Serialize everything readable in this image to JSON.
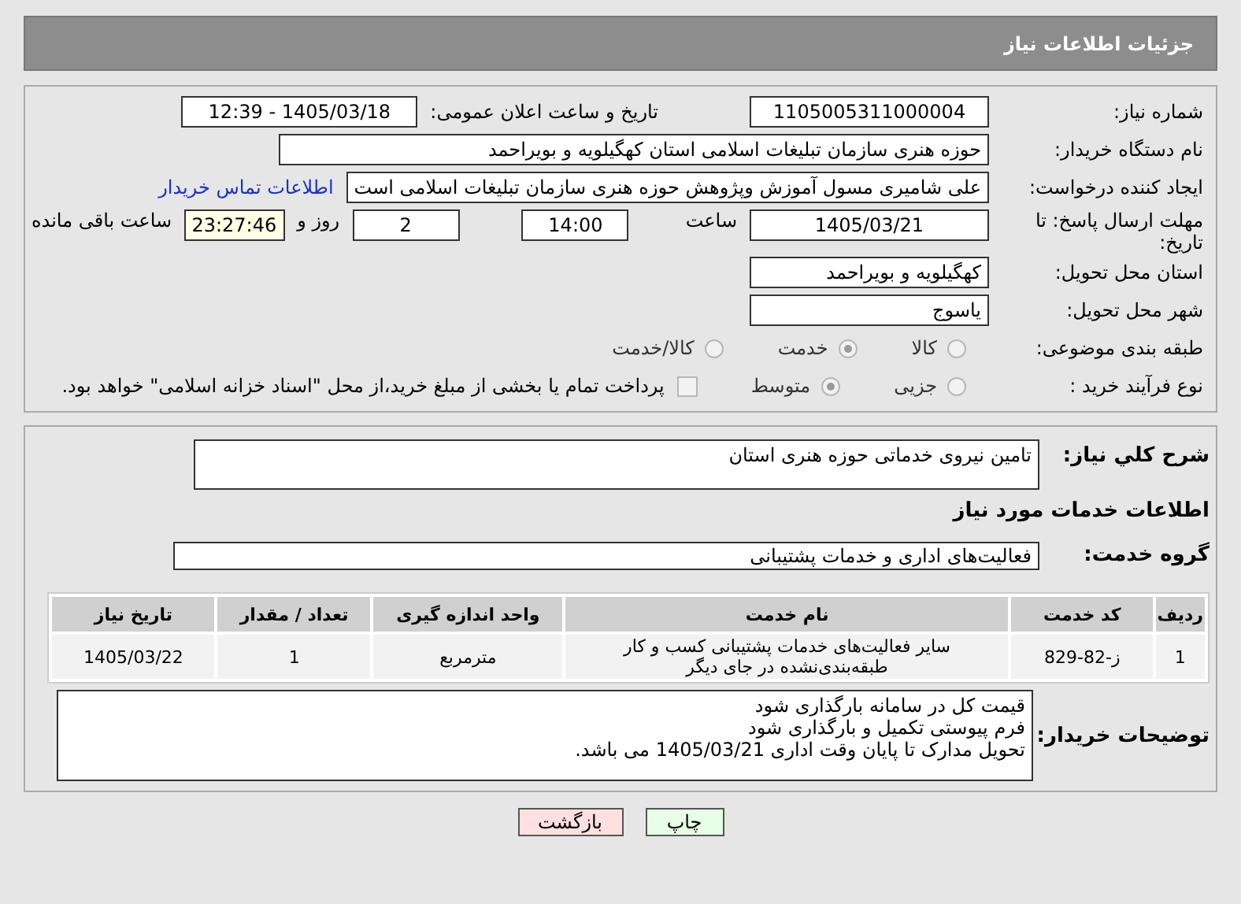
{
  "header": {
    "title": "جزئیات اطلاعات نیاز"
  },
  "details": {
    "need_number": {
      "label": "شماره نیاز:",
      "value": "1105005311000004"
    },
    "announce": {
      "label": "تاریخ و ساعت اعلان عمومی:",
      "value": "1405/03/18 - 12:39"
    },
    "buyer": {
      "label": "نام دستگاه خریدار:",
      "value": "حوزه هنری سازمان تبلیغات اسلامی استان کهگیلویه و بویراحمد"
    },
    "creator": {
      "label": "ایجاد کننده درخواست:",
      "value": "علی شامیری مسول آموزش وپژوهش حوزه هنری سازمان تبلیغات اسلامی است",
      "link": "اطلاعات تماس خریدار"
    },
    "deadline": {
      "label": "مهلت ارسال پاسخ: تا تاریخ:",
      "date": "1405/03/21",
      "time_label": "ساعت",
      "time": "14:00",
      "days": "2",
      "days_label": "روز و",
      "remaining": "23:27:46",
      "remaining_label": "ساعت باقی مانده"
    },
    "province": {
      "label": "استان محل تحویل:",
      "value": "کهگیلویه و بویراحمد"
    },
    "city": {
      "label": "شهر محل تحویل:",
      "value": "یاسوج"
    },
    "category": {
      "label": "طبقه بندی موضوعی:",
      "options": [
        {
          "label": "کالا",
          "selected": false
        },
        {
          "label": "خدمت",
          "selected": true
        },
        {
          "label": "کالا/خدمت",
          "selected": false
        }
      ]
    },
    "process": {
      "label": "نوع فرآیند خرید :",
      "options": [
        {
          "label": "جزیی",
          "selected": false
        },
        {
          "label": "متوسط",
          "selected": true
        }
      ],
      "payment": {
        "checked": false,
        "text": "پرداخت تمام یا بخشی از مبلغ خرید،از محل \"اسناد خزانه اسلامی\" خواهد بود."
      }
    }
  },
  "needs": {
    "summary": {
      "label": "شرح کلي نیاز:",
      "value": "تامین نیروی خدماتی حوزه هنری استان"
    },
    "services_heading": "اطلاعات خدمات مورد نیاز",
    "group": {
      "label": "گروه خدمت:",
      "value": "فعالیت‌های اداری و خدمات پشتیبانی"
    },
    "table": {
      "columns": [
        "ردیف",
        "کد خدمت",
        "نام خدمت",
        "واحد اندازه گیری",
        "تعداد / مقدار",
        "تاریخ نیاز"
      ],
      "rows": [
        [
          "1",
          "ز-82-829",
          "سایر فعالیت‌های خدمات پشتیبانی کسب و کار طبقه‌بندی‌نشده در جای دیگر",
          "مترمربع",
          "1",
          "1405/03/22"
        ]
      ]
    },
    "buyer_notes": {
      "label": "توضیحات خریدار:",
      "lines": [
        "قیمت کل در سامانه بارگذاری شود",
        "فرم پیوستی تکمیل و بارگذاری شود",
        "تحویل مدارک تا پایان وقت اداری 1405/03/21 می باشد."
      ]
    }
  },
  "buttons": [
    {
      "kind": "print",
      "label": "چاپ"
    },
    {
      "kind": "back",
      "label": "بازگشت"
    }
  ]
}
